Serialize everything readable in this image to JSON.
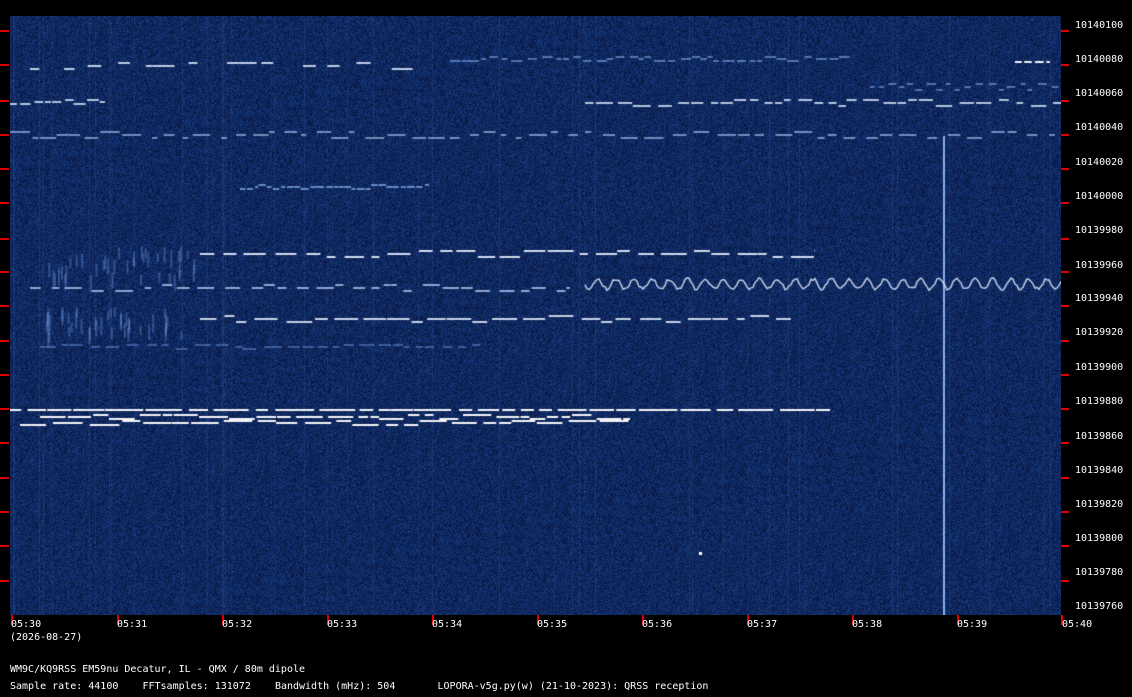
{
  "freq_labels": [
    "10140100",
    "10140080",
    "10140060",
    "10140040",
    "10140020",
    "10140000",
    "10139980",
    "10139960",
    "10139940",
    "10139920",
    "10139900",
    "10139880",
    "10139860",
    "10139840",
    "10139820",
    "10139800",
    "10139780",
    "10139760"
  ],
  "time_labels": [
    "05:30",
    "05:31",
    "05:32",
    "05:33",
    "05:34",
    "05:35",
    "05:36",
    "05:37",
    "05:38",
    "05:39",
    "05:40"
  ],
  "date_label": "(2026-08-27)",
  "station_label": "WM9C/KQ9RSS EM59nu Decatur, IL - QMX / 80m dipole",
  "info": {
    "sample_rate": "Sample rate: 44100",
    "fft_samples": "FFTsamples: 131072",
    "bandwidth": "Bandwidth (mHz): 504",
    "software": "LOPORA-v5g.py(w) (21-10-2023): QRSS reception"
  },
  "colors": {
    "background": "#0a1a4a",
    "signal": "#ffffff",
    "tick": "#e00000"
  }
}
